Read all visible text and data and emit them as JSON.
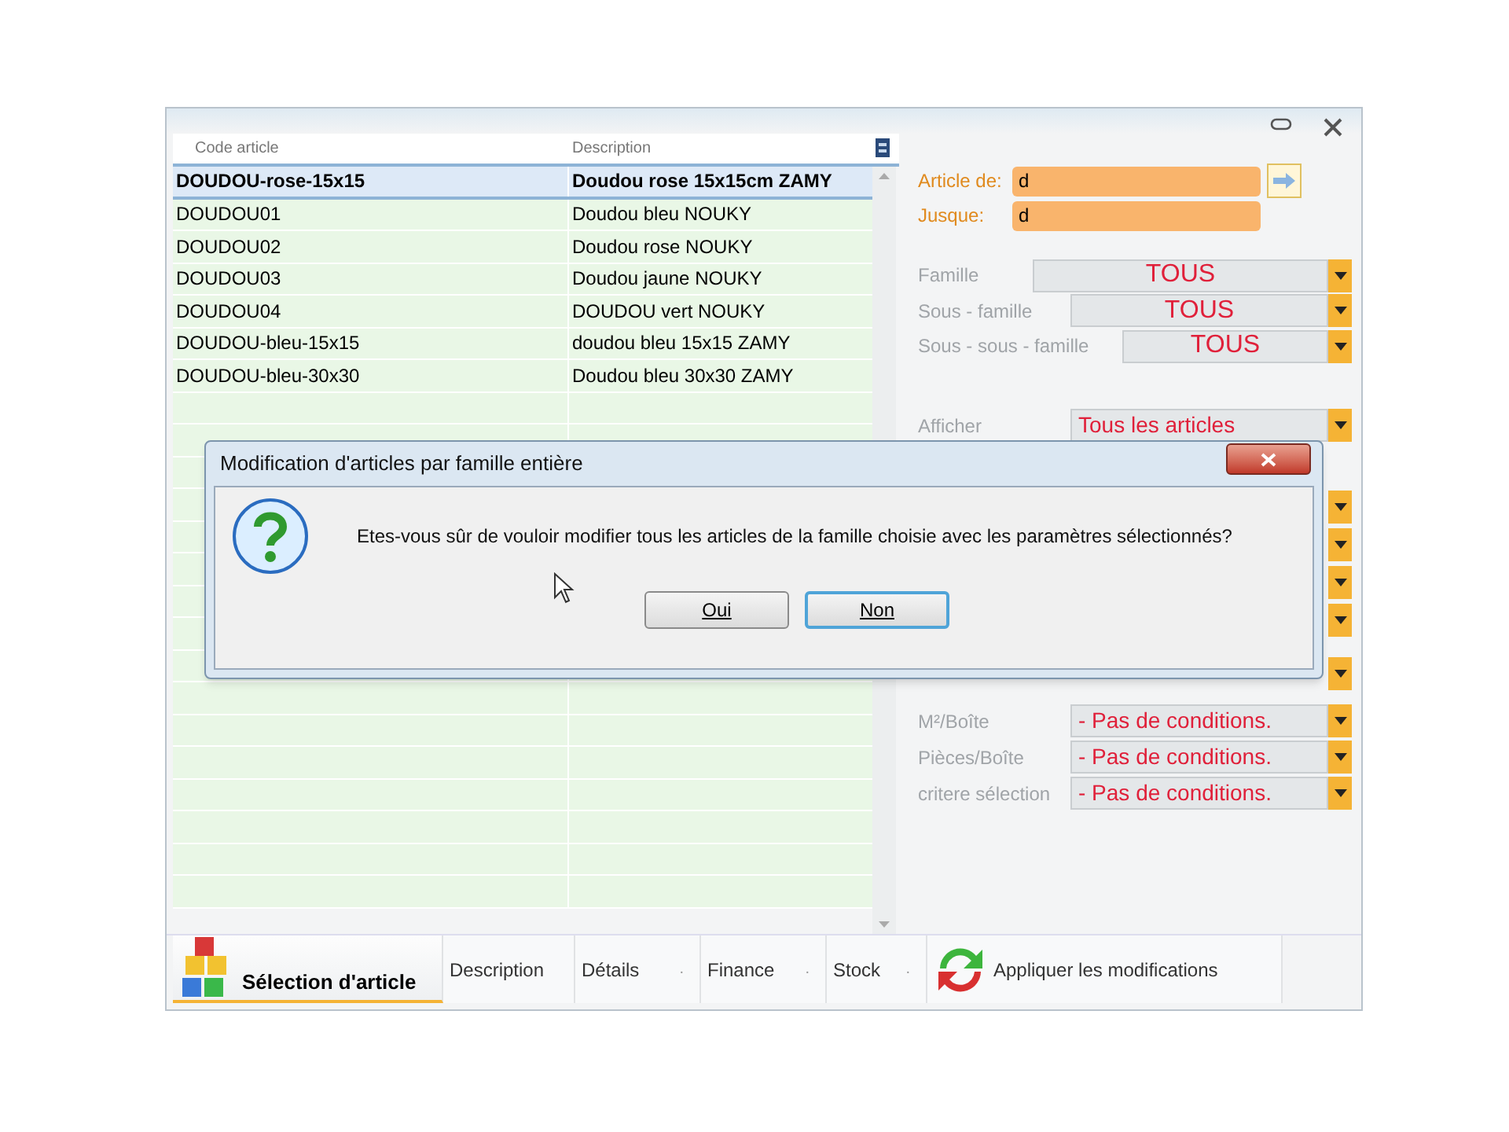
{
  "table": {
    "columns": [
      "Code article",
      "Description"
    ],
    "rows": [
      {
        "code": "DOUDOU-rose-15x15",
        "description": "Doudou rose 15x15cm ZAMY",
        "selected": true
      },
      {
        "code": "DOUDOU01",
        "description": "Doudou bleu NOUKY",
        "selected": false
      },
      {
        "code": "DOUDOU02",
        "description": "Doudou rose NOUKY",
        "selected": false
      },
      {
        "code": "DOUDOU03",
        "description": "Doudou jaune NOUKY",
        "selected": false
      },
      {
        "code": "DOUDOU04",
        "description": "DOUDOU vert NOUKY",
        "selected": false
      },
      {
        "code": "DOUDOU-bleu-15x15",
        "description": "doudou bleu 15x15 ZAMY",
        "selected": false
      },
      {
        "code": "DOUDOU-bleu-30x30",
        "description": "Doudou bleu 30x30 ZAMY",
        "selected": false
      }
    ]
  },
  "range": [
    {
      "label": "Article de:",
      "value": "d"
    },
    {
      "label": "Jusque:",
      "value": "d"
    }
  ],
  "filters": [
    {
      "label": "Famille",
      "value": "TOUS"
    },
    {
      "label": "Sous - famille",
      "value": "TOUS"
    },
    {
      "label": "Sous - sous - famille",
      "value": "TOUS"
    },
    {
      "label": "Afficher",
      "value": "Tous les articles"
    }
  ],
  "conditions": [
    {
      "label": "M²/Boîte",
      "value": "- Pas de conditions."
    },
    {
      "label": "Pièces/Boîte",
      "value": "- Pas de conditions."
    },
    {
      "label": "critere sélection",
      "value": "- Pas de conditions."
    }
  ],
  "tabs": [
    {
      "label": "Sélection d'article",
      "selected": true
    },
    {
      "label": "Description",
      "selected": false
    },
    {
      "label": "Détails",
      "suffix": ".",
      "selected": false
    },
    {
      "label": "Finance",
      "suffix": ".",
      "selected": false
    },
    {
      "label": "Stock",
      "suffix": ".",
      "selected": false
    },
    {
      "label": "Appliquer les modifications",
      "selected": false
    }
  ],
  "dialog": {
    "title": "Modification d'articles par famille entière",
    "message": "Etes-vous sûr de vouloir modifier tous les articles de la famille choisie avec les paramètres sélectionnés?",
    "buttons": [
      {
        "label": "Oui",
        "default": false
      },
      {
        "label": "Non",
        "default": true
      }
    ]
  }
}
